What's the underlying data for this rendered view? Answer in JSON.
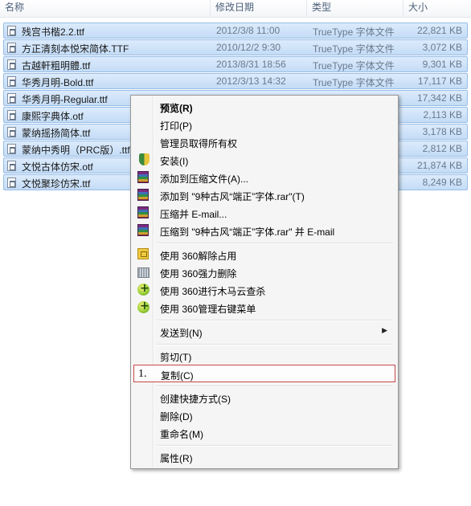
{
  "header": {
    "name": "名称",
    "date": "修改日期",
    "type": "类型",
    "size": "大小"
  },
  "files": [
    {
      "name": "残宫书楷2.2.ttf",
      "date": "2012/3/8 11:00",
      "type": "TrueType 字体文件",
      "size": "22,821 KB"
    },
    {
      "name": "方正清刻本悦宋简体.TTF",
      "date": "2010/12/2 9:30",
      "type": "TrueType 字体文件",
      "size": "3,072 KB"
    },
    {
      "name": "古越軒粗明體.ttf",
      "date": "2013/8/31 18:56",
      "type": "TrueType 字体文件",
      "size": "9,301 KB"
    },
    {
      "name": "华秀月明-Bold.ttf",
      "date": "2012/3/13 14:32",
      "type": "TrueType 字体文件",
      "size": "17,117 KB"
    },
    {
      "name": "华秀月明-Regular.ttf",
      "date": "",
      "type": "",
      "size": "17,342 KB"
    },
    {
      "name": "康熙字典体.otf",
      "date": "",
      "type": "",
      "size": "2,113 KB"
    },
    {
      "name": "蒙纳摇扬简体.ttf",
      "date": "",
      "type": "",
      "size": "3,178 KB"
    },
    {
      "name": "蒙纳中秀明（PRC版）.ttf",
      "date": "",
      "type": "",
      "size": "2,812 KB"
    },
    {
      "name": "文悦古体仿宋.otf",
      "date": "",
      "type": "",
      "size": "21,874 KB"
    },
    {
      "name": "文悦聚珍仿宋.ttf",
      "date": "",
      "type": "",
      "size": "8,249 KB"
    }
  ],
  "menu": {
    "preview": "预览(R)",
    "print": "打印(P)",
    "take_ownership": "管理员取得所有权",
    "install": "安装(I)",
    "add_archive": "添加到压缩文件(A)...",
    "add_to_rar": "添加到 \"9种古风“端正”字体.rar\"(T)",
    "compress_email": "压缩并 E-mail...",
    "compress_rar_email": "压缩到 \"9种古风“端正”字体.rar\" 并 E-mail",
    "unlock_360": "使用 360解除占用",
    "shred_360": "使用 360强力删除",
    "scan_360": "使用 360进行木马云查杀",
    "manage_360": "使用 360管理右键菜单",
    "send_to": "发送到(N)",
    "cut": "剪切(T)",
    "copy": "复制(C)",
    "copy_marker": "1.",
    "shortcut": "创建快捷方式(S)",
    "delete": "删除(D)",
    "rename": "重命名(M)",
    "properties": "属性(R)",
    "submenu_arrow": "▶"
  },
  "colors": {
    "selection": "#c4dcf6",
    "highlight_border": "#c94747"
  }
}
